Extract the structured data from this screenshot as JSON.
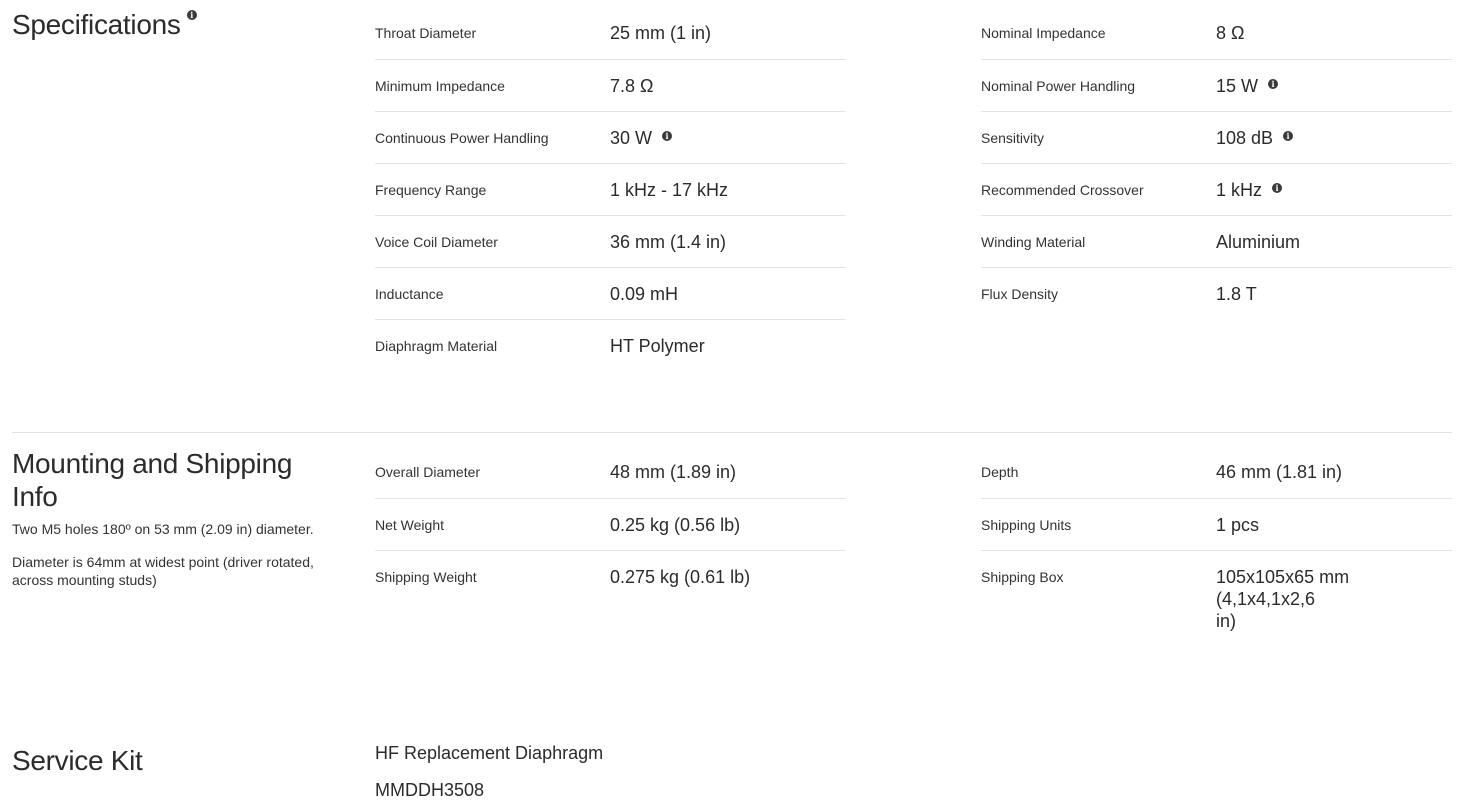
{
  "specs": {
    "title": "Specifications",
    "left": [
      {
        "label": "Throat Diameter",
        "value": "25 mm (1 in)",
        "info": false
      },
      {
        "label": "Minimum Impedance",
        "value": "7.8 Ω",
        "info": false
      },
      {
        "label": "Continuous Power Handling",
        "value": "30 W",
        "info": true
      },
      {
        "label": "Frequency Range",
        "value": "1 kHz - 17 kHz",
        "info": false
      },
      {
        "label": "Voice Coil Diameter",
        "value": "36 mm (1.4 in)",
        "info": false
      },
      {
        "label": "Inductance",
        "value": "0.09 mH",
        "info": false
      },
      {
        "label": "Diaphragm Material",
        "value": "HT Polymer",
        "info": false
      }
    ],
    "right": [
      {
        "label": "Nominal Impedance",
        "value": "8 Ω",
        "info": false
      },
      {
        "label": "Nominal Power Handling",
        "value": "15 W",
        "info": true
      },
      {
        "label": "Sensitivity",
        "value": "108 dB",
        "info": true
      },
      {
        "label": "Recommended Crossover",
        "value": "1 kHz",
        "info": true
      },
      {
        "label": "Winding Material",
        "value": "Aluminium",
        "info": false
      },
      {
        "label": "Flux Density",
        "value": "1.8 T",
        "info": false
      }
    ]
  },
  "mounting": {
    "title_line1": "Mounting and Shipping",
    "title_line2": "Info",
    "note1": "Two M5 holes 180º on 53 mm (2.09 in) diameter.",
    "note2_line1": "Diameter is 64mm at widest point (driver rotated,",
    "note2_line2": "across mounting studs)",
    "left": [
      {
        "label": "Overall Diameter",
        "value": "48 mm (1.89 in)"
      },
      {
        "label": "Net Weight",
        "value": "0.25 kg (0.56 lb)"
      },
      {
        "label": "Shipping Weight",
        "value": "0.275 kg (0.61 lb)"
      }
    ],
    "right": [
      {
        "label": "Depth",
        "value": "46 mm (1.81 in)"
      },
      {
        "label": "Shipping Units",
        "value": "1 pcs"
      },
      {
        "label": "Shipping Box",
        "value_line1": "105x105x65 mm (4,1x4,1x2,6",
        "value_line2": "in)"
      }
    ]
  },
  "service_kit": {
    "title": "Service Kit",
    "item_name": "HF Replacement Diaphragm",
    "item_code": "MMDDH3508"
  },
  "icons": {
    "info": "info-icon"
  }
}
